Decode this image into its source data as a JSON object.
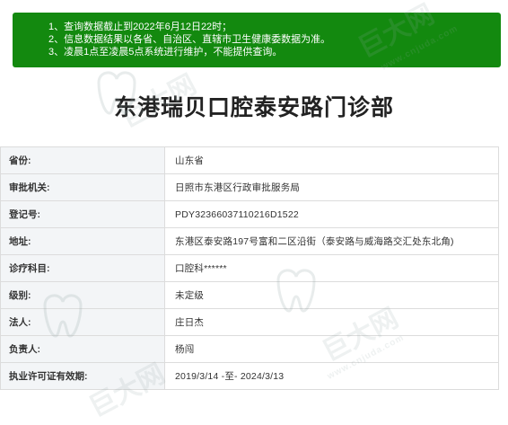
{
  "notice": {
    "lines": [
      "1、查询数据截止到2022年6月12日22时；",
      "2、信息数据结果以各省、自治区、直辖市卫生健康委数据为准。",
      "3、凌晨1点至凌晨5点系统进行维护，不能提供查询。"
    ]
  },
  "page": {
    "title": "东港瑞贝口腔泰安路门诊部"
  },
  "table": {
    "rows": [
      {
        "label": "省份:",
        "value": "山东省"
      },
      {
        "label": "审批机关:",
        "value": "日照市东港区行政审批服务局"
      },
      {
        "label": "登记号:",
        "value": "PDY32366037110216D1522"
      },
      {
        "label": "地址:",
        "value": "东港区泰安路197号富和二区沿街（泰安路与威海路交汇处东北角)"
      },
      {
        "label": "诊疗科目:",
        "value": "口腔科******"
      },
      {
        "label": "级别:",
        "value": "未定级"
      },
      {
        "label": "法人:",
        "value": "庄日杰"
      },
      {
        "label": "负责人:",
        "value": "杨闯"
      },
      {
        "label": "执业许可证有效期:",
        "value": "2019/3/14 -至- 2024/3/13"
      }
    ]
  },
  "watermark": {
    "brand": "巨大网",
    "site": "www.cnjuda.com"
  },
  "colors": {
    "notice_bg": "#13890f",
    "label_bg": "#f3f5f7",
    "border": "#dcdcdc"
  }
}
